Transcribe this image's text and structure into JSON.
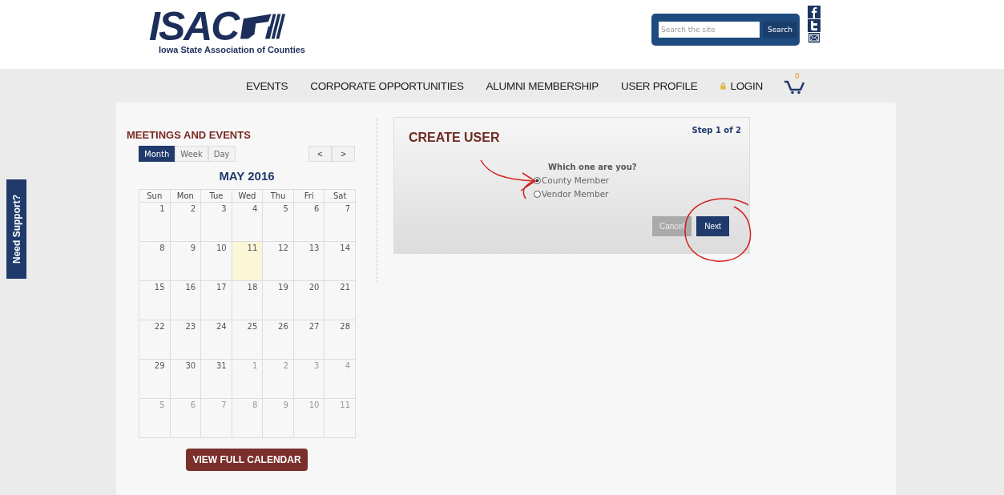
{
  "logo": {
    "abbr": "ISAC",
    "subtitle": "Iowa State Association of Counties"
  },
  "search": {
    "placeholder": "Search the site",
    "button": "Search"
  },
  "nav": {
    "items": [
      {
        "label": "EVENTS",
        "kind": "link"
      },
      {
        "label": "CORPORATE OPPORTUNITIES",
        "kind": "link"
      },
      {
        "label": "ALUMNI MEMBERSHIP",
        "kind": "link"
      },
      {
        "label": "USER PROFILE",
        "kind": "link"
      },
      {
        "label": "LOGIN",
        "kind": "login"
      }
    ],
    "cart_count": "0"
  },
  "support_tab": "Need Support?",
  "calendar": {
    "title": "MEETINGS AND EVENTS",
    "views": [
      {
        "label": "Month",
        "selected": true
      },
      {
        "label": "Week",
        "selected": false
      },
      {
        "label": "Day",
        "selected": false
      }
    ],
    "prev": "<",
    "next": ">",
    "month": "MAY 2016",
    "weekdays": [
      "Sun",
      "Mon",
      "Tue",
      "Wed",
      "Thu",
      "Fri",
      "Sat"
    ],
    "weeks": [
      [
        {
          "day": "1",
          "muted": false,
          "today": false
        },
        {
          "day": "2",
          "muted": false,
          "today": false
        },
        {
          "day": "3",
          "muted": false,
          "today": false
        },
        {
          "day": "4",
          "muted": false,
          "today": false
        },
        {
          "day": "5",
          "muted": false,
          "today": false
        },
        {
          "day": "6",
          "muted": false,
          "today": false
        },
        {
          "day": "7",
          "muted": false,
          "today": false
        }
      ],
      [
        {
          "day": "8",
          "muted": false,
          "today": false
        },
        {
          "day": "9",
          "muted": false,
          "today": false
        },
        {
          "day": "10",
          "muted": false,
          "today": false
        },
        {
          "day": "11",
          "muted": false,
          "today": true
        },
        {
          "day": "12",
          "muted": false,
          "today": false
        },
        {
          "day": "13",
          "muted": false,
          "today": false
        },
        {
          "day": "14",
          "muted": false,
          "today": false
        }
      ],
      [
        {
          "day": "15",
          "muted": false,
          "today": false
        },
        {
          "day": "16",
          "muted": false,
          "today": false
        },
        {
          "day": "17",
          "muted": false,
          "today": false
        },
        {
          "day": "18",
          "muted": false,
          "today": false
        },
        {
          "day": "19",
          "muted": false,
          "today": false
        },
        {
          "day": "20",
          "muted": false,
          "today": false
        },
        {
          "day": "21",
          "muted": false,
          "today": false
        }
      ],
      [
        {
          "day": "22",
          "muted": false,
          "today": false
        },
        {
          "day": "23",
          "muted": false,
          "today": false
        },
        {
          "day": "24",
          "muted": false,
          "today": false
        },
        {
          "day": "25",
          "muted": false,
          "today": false
        },
        {
          "day": "26",
          "muted": false,
          "today": false
        },
        {
          "day": "27",
          "muted": false,
          "today": false
        },
        {
          "day": "28",
          "muted": false,
          "today": false
        }
      ],
      [
        {
          "day": "29",
          "muted": false,
          "today": false
        },
        {
          "day": "30",
          "muted": false,
          "today": false
        },
        {
          "day": "31",
          "muted": false,
          "today": false
        },
        {
          "day": "1",
          "muted": true,
          "today": false
        },
        {
          "day": "2",
          "muted": true,
          "today": false
        },
        {
          "day": "3",
          "muted": true,
          "today": false
        },
        {
          "day": "4",
          "muted": true,
          "today": false
        }
      ],
      [
        {
          "day": "5",
          "muted": true,
          "today": false
        },
        {
          "day": "6",
          "muted": true,
          "today": false
        },
        {
          "day": "7",
          "muted": true,
          "today": false
        },
        {
          "day": "8",
          "muted": true,
          "today": false
        },
        {
          "day": "9",
          "muted": true,
          "today": false
        },
        {
          "day": "10",
          "muted": true,
          "today": false
        },
        {
          "day": "11",
          "muted": true,
          "today": false
        }
      ]
    ],
    "button": "VIEW FULL CALENDAR"
  },
  "create_user": {
    "title": "CREATE USER",
    "step": "Step 1 of 2",
    "question": "Which one are you?",
    "options": [
      {
        "label": "County Member",
        "selected": true
      },
      {
        "label": "Vendor Member",
        "selected": false
      }
    ],
    "cancel": "Cancel",
    "next": "Next"
  }
}
